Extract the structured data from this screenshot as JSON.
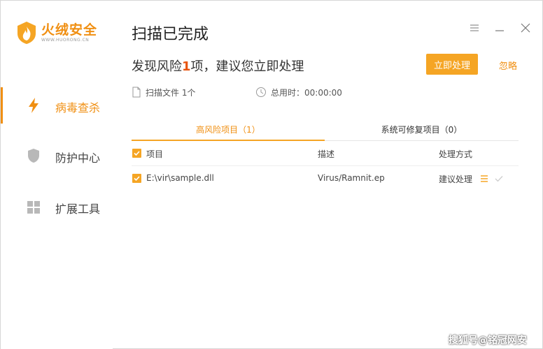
{
  "app": {
    "logo_text": "火绒安全",
    "logo_sub": "WWW.HUORONG.CN"
  },
  "sidebar": {
    "items": [
      {
        "label": "病毒查杀",
        "icon": "lightning-icon",
        "active": true
      },
      {
        "label": "防护中心",
        "icon": "shield-icon",
        "active": false
      },
      {
        "label": "扩展工具",
        "icon": "grid-icon",
        "active": false
      }
    ]
  },
  "header": {
    "title": "扫描已完成",
    "risk_prefix": "发现风险",
    "risk_count": "1",
    "risk_suffix": "项，建议您立即处理",
    "primary_button": "立即处理",
    "ignore_link": "忽略"
  },
  "stats": {
    "files_scanned": "扫描文件 1个",
    "time_used": "总用时：00:00:00"
  },
  "tabs": [
    {
      "label": "高风险项目（1）",
      "active": true
    },
    {
      "label": "系统可修复项目（0）",
      "active": false
    }
  ],
  "table": {
    "columns": [
      "项目",
      "描述",
      "处理方式"
    ],
    "rows": [
      {
        "item": "E:\\vir\\sample.dll",
        "description": "Virus/Ramnit.ep",
        "action": "建议处理",
        "checked": true
      }
    ]
  },
  "watermark": "搜狐号@铭冠网安",
  "colors": {
    "accent": "#f5a524",
    "accent_text": "#f08f12",
    "risk": "#e8540f"
  }
}
